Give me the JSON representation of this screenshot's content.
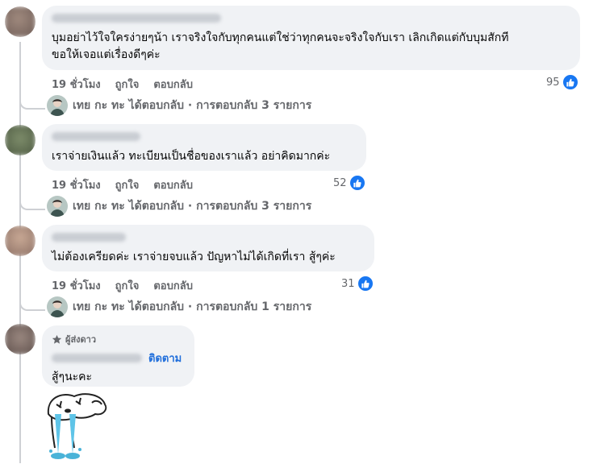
{
  "comments": [
    {
      "text_line1": "บุมอย่าไว้ใจใครง่ายๆน้า เราจริงใจกับทุกคนแต่ใช่ว่าทุกคนจะจริงใจกับเรา เลิกเกิดแต่กับบุมสักที",
      "text_line2": "ขอให้เจอแต่เรื่องดีๆค่ะ",
      "time": "19 ชั่วโมง",
      "like": "ถูกใจ",
      "reply": "ตอบกลับ",
      "reactions": "95",
      "replies_summary": "เทย กะ ทะ ได้ตอบกลับ · การตอบกลับ 3 รายการ"
    },
    {
      "text_line1": "เราจ่ายเงินแล้ว ทะเบียนเป็นชื่อของเราแล้ว อย่าคิดมากค่ะ",
      "time": "19 ชั่วโมง",
      "like": "ถูกใจ",
      "reply": "ตอบกลับ",
      "reactions": "52",
      "replies_summary": "เทย กะ ทะ ได้ตอบกลับ · การตอบกลับ 3 รายการ"
    },
    {
      "text_line1": "ไม่ต้องเครียดค่ะ เราจ่ายจบแล้ว ปัญหาไม่ได้เกิดที่เรา สู้ๆค่ะ",
      "time": "19 ชั่วโมง",
      "like": "ถูกใจ",
      "reply": "ตอบกลับ",
      "reactions": "31",
      "replies_summary": "เทย กะ ทะ ได้ตอบกลับ · การตอบกลับ 1 รายการ"
    },
    {
      "badge": "ผู้ส่งดาว",
      "follow": "ติดตาม",
      "text_line1": "สู้ๆนะคะ"
    }
  ],
  "colors": {
    "bubble": "#f0f2f5",
    "link": "#216fdb",
    "like_blue": "#1877f2",
    "meta_gray": "#65676b"
  }
}
